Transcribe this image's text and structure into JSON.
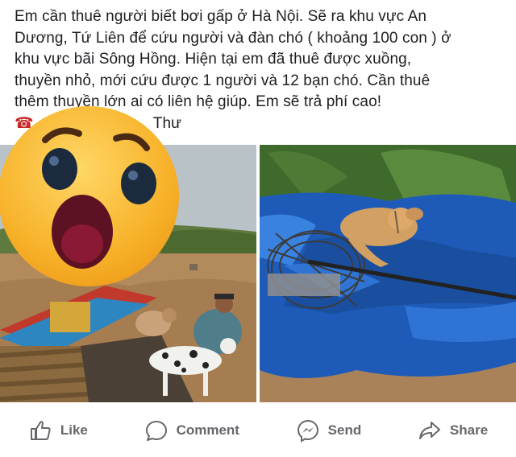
{
  "post": {
    "lines": [
      "Em cần thuê người biết bơi gấp ở Hà Nội. Sẽ ra khu vực An",
      "Dương, Tứ Liên để cứu người và đàn chó ( khoảng 100 con ) ở",
      "khu vực bãi Sông Hồng. Hiện tại em đã thuê được xuồng,",
      "thuyền nhỏ, mới cứu được 1 người và 12 bạn chó. Cần thuê",
      "thêm thuyền lớn ai có liên hệ giúp. Em sẽ trả phí cao!"
    ],
    "phone_icon": "☎",
    "author_partial": "Thư"
  },
  "photos": [
    {
      "name": "photo-flood-boat-dogs"
    },
    {
      "name": "photo-dog-on-tarp"
    }
  ],
  "overlay": {
    "icon": "wow-emoji-icon"
  },
  "actions": [
    {
      "label": "Like",
      "icon": "like-icon"
    },
    {
      "label": "Comment",
      "icon": "comment-icon"
    },
    {
      "label": "Send",
      "icon": "messenger-icon"
    },
    {
      "label": "Share",
      "icon": "share-icon"
    }
  ],
  "colors": {
    "text": "#1c1e21",
    "action": "#65676b",
    "tarp": "#1565c0",
    "emoji": "#f7b22a"
  }
}
